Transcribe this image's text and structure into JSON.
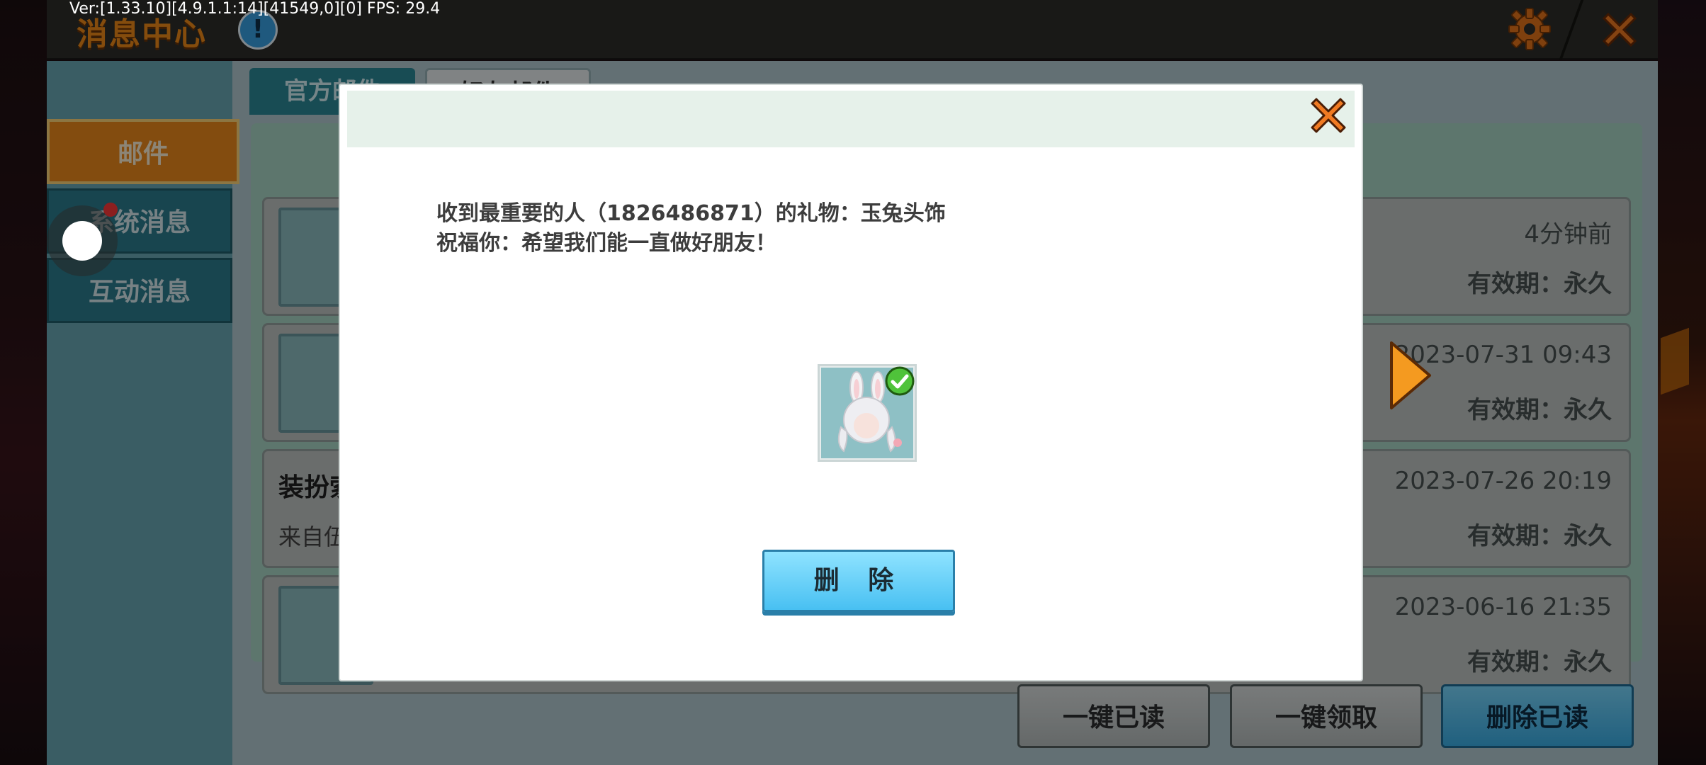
{
  "debug": {
    "fps_text": "Ver:[1.33.10][4.9.1.1:14][41549,0][0] FPS: 29.4"
  },
  "window": {
    "title": "消息中心"
  },
  "sidebar": {
    "items": [
      {
        "label": "邮件"
      },
      {
        "label": "系统消息"
      },
      {
        "label": "互动消息"
      }
    ]
  },
  "tabs": [
    {
      "label": "官方邮件"
    },
    {
      "label": "好友邮件"
    }
  ],
  "mail_list": [
    {
      "time": "4分钟前",
      "expire": "有效期：永久"
    },
    {
      "time": "2023-07-31 09:43",
      "expire": "有效期：永久"
    },
    {
      "title": "装扮索",
      "from": "来自伍",
      "time": "2023-07-26 20:19",
      "expire": "有效期：永久"
    },
    {
      "time": "2023-06-16 21:35",
      "expire": "有效期：永久"
    }
  ],
  "bottom_buttons": {
    "read_all": "一键已读",
    "claim_all": "一键领取",
    "delete_read": "删除已读"
  },
  "dialog": {
    "message_line1": "收到最重要的人（1826486871）的礼物：玉兔头饰",
    "message_line2": "祝福你：希望我们能一直做好朋友！",
    "delete_label": "删 除",
    "item_claimed": true
  },
  "colors": {
    "accent_orange": "#f08a18",
    "primary_blue": "#48c0f2",
    "panel_teal": "#2c8a9a"
  },
  "icons": {
    "info": "info-icon",
    "settings": "gear-icon",
    "close": "close-icon",
    "claimed": "check-icon",
    "next": "right-arrow-icon"
  }
}
